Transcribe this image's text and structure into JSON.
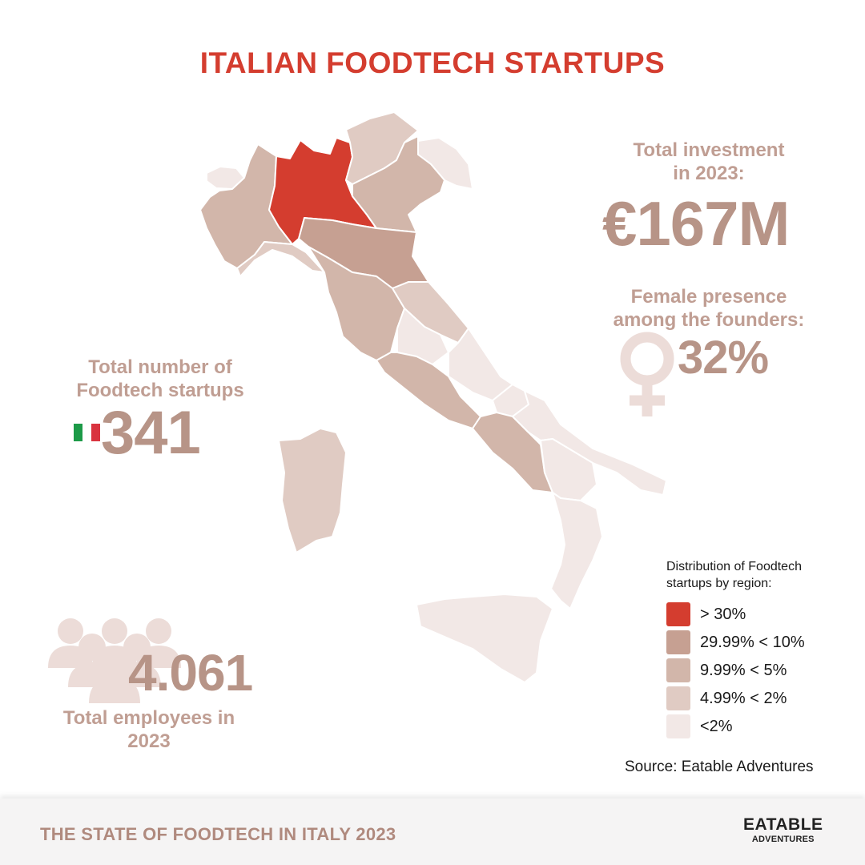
{
  "title": "ITALIAN FOODTECH STARTUPS",
  "colors": {
    "title": "#d43d2f",
    "stat": "#c09e93",
    "stat_dark": "#b79487",
    "icon": "#ecdcd8",
    "footer_text": "#b08a7e"
  },
  "investment": {
    "label": "Total investment\nin 2023:",
    "value": "€167M"
  },
  "female": {
    "label": "Female presence\namong the founders:",
    "value": "32%",
    "icon": "female-symbol-icon"
  },
  "startups": {
    "label": "Total number of\nFoodtech startups",
    "value": "341",
    "icon": "italian-flag-icon"
  },
  "employees": {
    "value": "4.061",
    "label": "Total employees in\n2023",
    "icon": "people-group-icon"
  },
  "legend": {
    "title": "Distribution of Foodtech\nstartups by region:",
    "items": [
      {
        "label": "> 30%",
        "color": "#d43d2f"
      },
      {
        "label": "29.99% < 10%",
        "color": "#c6a092"
      },
      {
        "label": "9.99% < 5%",
        "color": "#d2b6aa"
      },
      {
        "label": "4.99% < 2%",
        "color": "#e0cbc3"
      },
      {
        "label": "<2%",
        "color": "#f2e8e6"
      }
    ]
  },
  "regions": [
    {
      "name": "Lombardia",
      "level": 0
    },
    {
      "name": "Emilia-Romagna",
      "level": 1
    },
    {
      "name": "Piemonte",
      "level": 2
    },
    {
      "name": "Veneto",
      "level": 2
    },
    {
      "name": "Toscana",
      "level": 2
    },
    {
      "name": "Lazio",
      "level": 2
    },
    {
      "name": "Campania",
      "level": 2
    },
    {
      "name": "Trentino-Alto Adige",
      "level": 3
    },
    {
      "name": "Liguria",
      "level": 3
    },
    {
      "name": "Marche",
      "level": 3
    },
    {
      "name": "Sardegna",
      "level": 3
    },
    {
      "name": "Valle d'Aosta",
      "level": 4
    },
    {
      "name": "Friuli-Venezia Giulia",
      "level": 4
    },
    {
      "name": "Umbria",
      "level": 4
    },
    {
      "name": "Abruzzo",
      "level": 4
    },
    {
      "name": "Molise",
      "level": 4
    },
    {
      "name": "Puglia",
      "level": 4
    },
    {
      "name": "Basilicata",
      "level": 4
    },
    {
      "name": "Calabria",
      "level": 4
    },
    {
      "name": "Sicilia",
      "level": 4
    }
  ],
  "source": "Source: Eatable Adventures",
  "footer": {
    "text": "THE STATE OF FOODTECH IN ITALY 2023",
    "logo_line1": "EATABLE",
    "logo_line2": "ADVENTURES"
  }
}
